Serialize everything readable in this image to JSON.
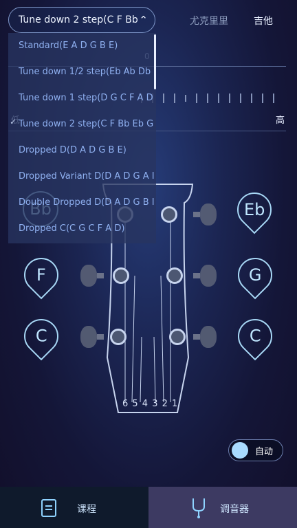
{
  "header": {
    "tuning_selected": "Tune down 2 step(C F Bb",
    "tab_ukulele": "尤克里里",
    "tab_guitar": "吉他"
  },
  "meter": {
    "zero": "0",
    "low": "低",
    "high": "高"
  },
  "dropdown": {
    "items": [
      "Standard(E A D G B E)",
      "Tune down 1/2 step(Eb Ab Db",
      "Tune down 1 step(D G C F A D",
      "Tune down 2 step(C F Bb Eb G",
      "Dropped D(D A D G B E)",
      "Dropped Variant D(D A D G A I",
      "Double Dropped D(D A D G B I",
      "Dropped C(C G C F A D)"
    ],
    "checked_index": 3
  },
  "pegs": {
    "left": [
      "Bb",
      "F",
      "C"
    ],
    "right": [
      "Eb",
      "G",
      "C"
    ]
  },
  "string_numbers": "6 5 4 3 2 1",
  "auto_toggle": {
    "label": "自动",
    "on": true
  },
  "bottom_nav": {
    "lessons": "课程",
    "tuner": "调音器"
  },
  "colors": {
    "accent": "#a7d7f5",
    "nav_active": "#3d3a62",
    "nav_inactive": "#0f1a2c"
  }
}
